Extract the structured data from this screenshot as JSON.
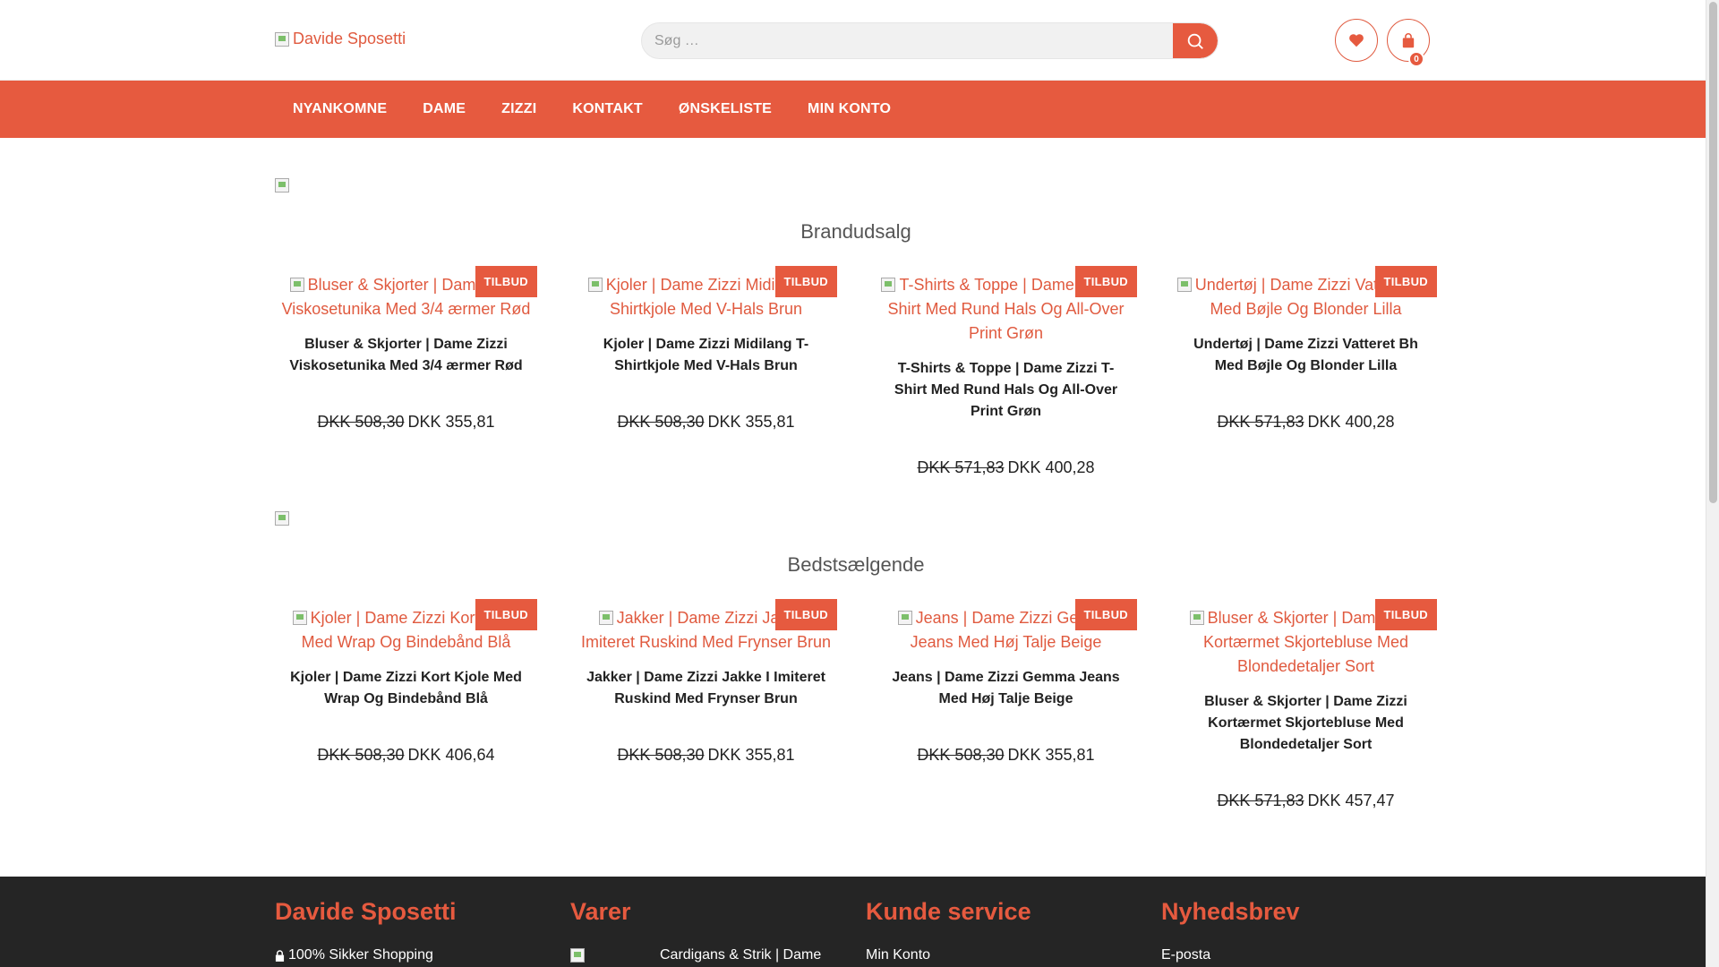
{
  "header": {
    "logo_alt": "Davide Sposetti",
    "search_placeholder": "Søg …",
    "cart_count": "0"
  },
  "nav": {
    "items": [
      "NYANKOMNE",
      "DAME",
      "ZIZZI",
      "KONTAKT",
      "ØNSKELISTE",
      "MIN KONTO"
    ]
  },
  "sections": [
    {
      "title": "Brandudsalg",
      "products": [
        {
          "image_alt": "Bluser & Skjorter | Dame Zizzi Viskosetunika Med 3/4 ærmer Rød",
          "tag": "TILBUD",
          "name": "Bluser & Skjorter | Dame Zizzi Viskosetunika Med 3/4 ærmer Rød",
          "old_price": "DKK 508,30",
          "price": "DKK 355,81"
        },
        {
          "image_alt": "Kjoler | Dame Zizzi Midilang T-Shirtkjole Med V-Hals Brun",
          "tag": "TILBUD",
          "name": "Kjoler | Dame Zizzi Midilang T-Shirtkjole Med V-Hals Brun",
          "old_price": "DKK 508,30",
          "price": "DKK 355,81"
        },
        {
          "image_alt": "T-Shirts & Toppe | Dame Zizzi T-Shirt Med Rund Hals Og All-Over Print Grøn",
          "tag": "TILBUD",
          "name": "T-Shirts & Toppe | Dame Zizzi T-Shirt Med Rund Hals Og All-Over Print Grøn",
          "old_price": "DKK 571,83",
          "price": "DKK 400,28"
        },
        {
          "image_alt": "Undertøj | Dame Zizzi Vatteret Bh Med Bøjle Og Blonder Lilla",
          "tag": "TILBUD",
          "name": "Undertøj | Dame Zizzi Vatteret Bh Med Bøjle Og Blonder Lilla",
          "old_price": "DKK 571,83",
          "price": "DKK 400,28"
        }
      ]
    },
    {
      "title": "Bedstsælgende",
      "products": [
        {
          "image_alt": "Kjoler | Dame Zizzi Kort Kjole Med Wrap Og Bindebånd Blå",
          "tag": "TILBUD",
          "name": "Kjoler | Dame Zizzi Kort Kjole Med Wrap Og Bindebånd Blå",
          "old_price": "DKK 508,30",
          "price": "DKK 406,64"
        },
        {
          "image_alt": "Jakker | Dame Zizzi Jakke I Imiteret Ruskind Med Frynser Brun",
          "tag": "TILBUD",
          "name": "Jakker | Dame Zizzi Jakke I Imiteret Ruskind Med Frynser Brun",
          "old_price": "DKK 508,30",
          "price": "DKK 355,81"
        },
        {
          "image_alt": "Jeans | Dame Zizzi Gemma Jeans Med Høj Talje Beige",
          "tag": "TILBUD",
          "name": "Jeans | Dame Zizzi Gemma Jeans Med Høj Talje Beige",
          "old_price": "DKK 508,30",
          "price": "DKK 355,81"
        },
        {
          "image_alt": "Bluser & Skjorter | Dame Zizzi Kortærmet Skjortebluse Med Blondedetaljer Sort",
          "tag": "TILBUD",
          "name": "Bluser & Skjorter | Dame Zizzi Kortærmet Skjortebluse Med Blondedetaljer Sort",
          "old_price": "DKK 571,83",
          "price": "DKK 457,47"
        }
      ]
    }
  ],
  "footer": {
    "cols": [
      {
        "title": "Davide Sposetti",
        "line": "100% Sikker Shopping"
      },
      {
        "title": "Varer",
        "line": "Cardigans & Strik | Dame"
      },
      {
        "title": "Kunde service",
        "line": "Min Konto"
      },
      {
        "title": "Nyhedsbrev",
        "line": "E-posta"
      }
    ]
  },
  "colors": {
    "accent": "#e65a3f",
    "footer_bg": "#252525"
  }
}
